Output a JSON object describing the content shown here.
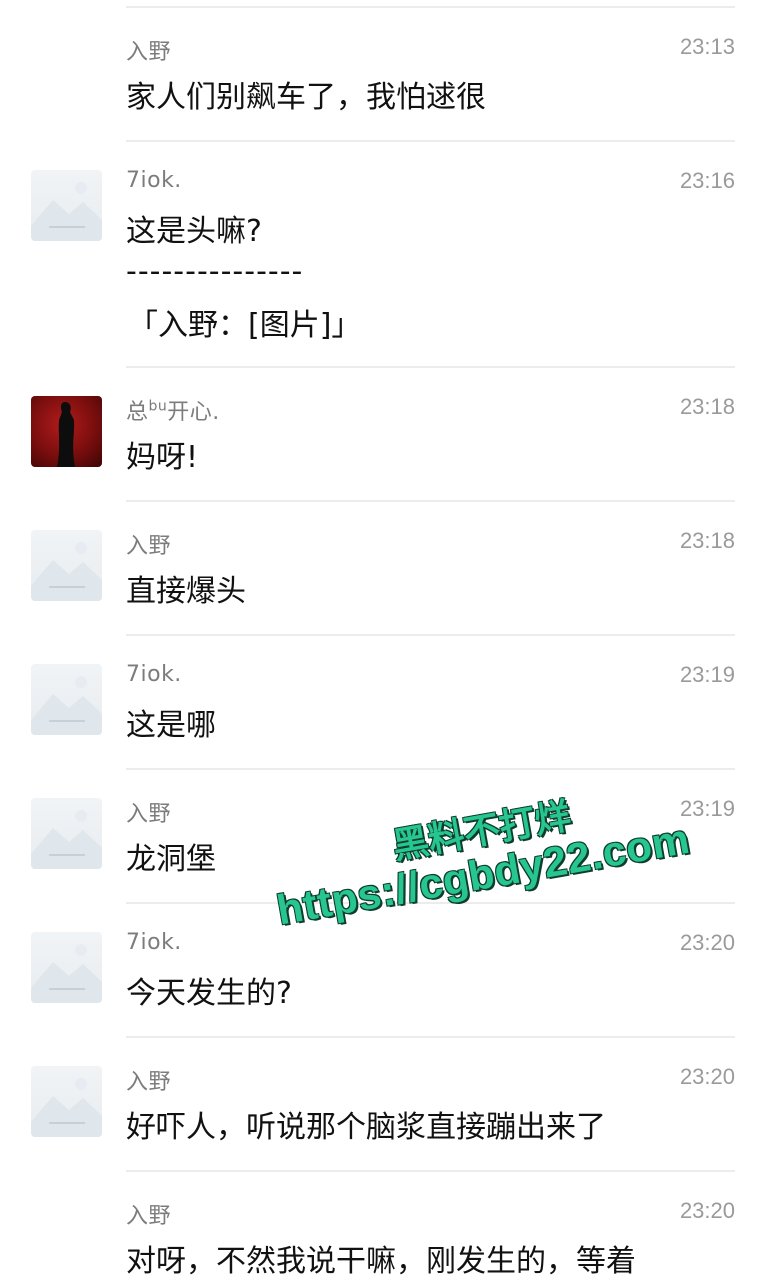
{
  "messages": [
    {
      "name": "入野",
      "time": "23:13",
      "text": "家人们别飙车了，我怕逑很",
      "avatar": "none"
    },
    {
      "name": "7iok.",
      "time": "23:16",
      "text": "这是头嘛?",
      "divider": "---------------",
      "quote": "「入野：[图片]」",
      "avatar": "placeholder"
    },
    {
      "name": "总",
      "name_sup": "bu",
      "name_tail": "开心.",
      "time": "23:18",
      "text": "妈呀!",
      "avatar": "photo"
    },
    {
      "name": "入野",
      "time": "23:18",
      "text": "直接爆头",
      "avatar": "placeholder"
    },
    {
      "name": "7iok.",
      "time": "23:19",
      "text": "这是哪",
      "avatar": "placeholder"
    },
    {
      "name": "入野",
      "time": "23:19",
      "text": "龙洞堡",
      "avatar": "placeholder"
    },
    {
      "name": "7iok.",
      "time": "23:20",
      "text": "今天发生的?",
      "avatar": "placeholder"
    },
    {
      "name": "入野",
      "time": "23:20",
      "text": "好吓人，听说那个脑浆直接蹦出来了",
      "avatar": "placeholder"
    },
    {
      "name": "入野",
      "time": "23:20",
      "text": "对呀，不然我说干嘛，刚发生的，等着",
      "avatar": "none"
    }
  ],
  "watermark": {
    "line1": "黑料不打烊",
    "line2": "https://cgbdy22.com"
  },
  "colors": {
    "name": "#7c7c7c",
    "time": "#9a9a9a",
    "text": "#111111",
    "divider": "#ececec",
    "watermark": "#27c58f"
  }
}
